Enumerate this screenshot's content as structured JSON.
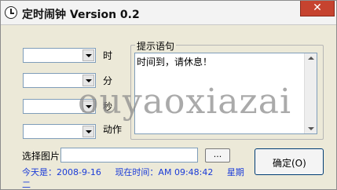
{
  "window": {
    "title": "定时闹钟 Version 0.2",
    "close_glyph": "✕"
  },
  "form": {
    "combos": [
      {
        "label": "时",
        "value": ""
      },
      {
        "label": "分",
        "value": ""
      },
      {
        "label": "秒",
        "value": ""
      },
      {
        "label": "动作",
        "value": ""
      }
    ]
  },
  "prompt": {
    "title": "提示语句",
    "text": "时间到，请休息！"
  },
  "image": {
    "label": "选择图片",
    "value": "",
    "browse_label": "..."
  },
  "ok_button": {
    "label": "确定(O)"
  },
  "status": {
    "today": "今天是：2008-9-16",
    "now": "现在时间：AM 09:48:42",
    "weekday_label": "星期",
    "weekday_value": "二"
  },
  "watermark": "ouyaoxiazai"
}
